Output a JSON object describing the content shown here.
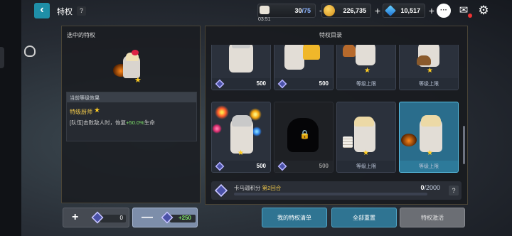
{
  "header": {
    "title": "特权",
    "back_icon": "chevron-left-icon",
    "help_label": "?",
    "resources": [
      {
        "icon": "coffee-cup-icon",
        "value": "30",
        "max": "/75",
        "sub": "03:51"
      },
      {
        "icon": "gold-coin-icon",
        "value": "226,735"
      },
      {
        "icon": "blue-gem-icon",
        "value": "10,517"
      }
    ],
    "plus_label": "+",
    "icons": [
      "chat-icon",
      "mail-icon",
      "gear-icon"
    ]
  },
  "left_panel": {
    "title": "选中的特权",
    "effect_header": "当前等级效果",
    "effect_name": "特级厨师",
    "effect_desc_pre": "[队伍]击败敌人时，恢复",
    "effect_desc_pct": "+50.0%",
    "effect_desc_post": "生命",
    "minus_value": "0",
    "plus_value": "+250"
  },
  "right_panel": {
    "title": "特权目录",
    "cards": [
      {
        "footer": "500",
        "state": "price"
      },
      {
        "footer": "500",
        "state": "price"
      },
      {
        "footer": "等级上限",
        "state": "max"
      },
      {
        "footer": "等级上限",
        "state": "max"
      },
      {
        "footer": "500",
        "state": "price"
      },
      {
        "footer": "500",
        "state": "locked"
      },
      {
        "footer": "等级上限",
        "state": "max"
      },
      {
        "footer": "等级上限",
        "state": "selected"
      }
    ],
    "progress": {
      "label": "卡马迦积分",
      "round": "第2回合",
      "current": "0",
      "max": "/2000",
      "fraction": 0
    },
    "help_label": "?"
  },
  "actions": {
    "my_list": "我的特权清单",
    "reset_all": "全部重置",
    "activate": "特权激活"
  },
  "colors": {
    "accent": "#2f7492",
    "selected": "#2a6d8c",
    "gold": "#f1c94b",
    "green": "#7fe36a"
  }
}
